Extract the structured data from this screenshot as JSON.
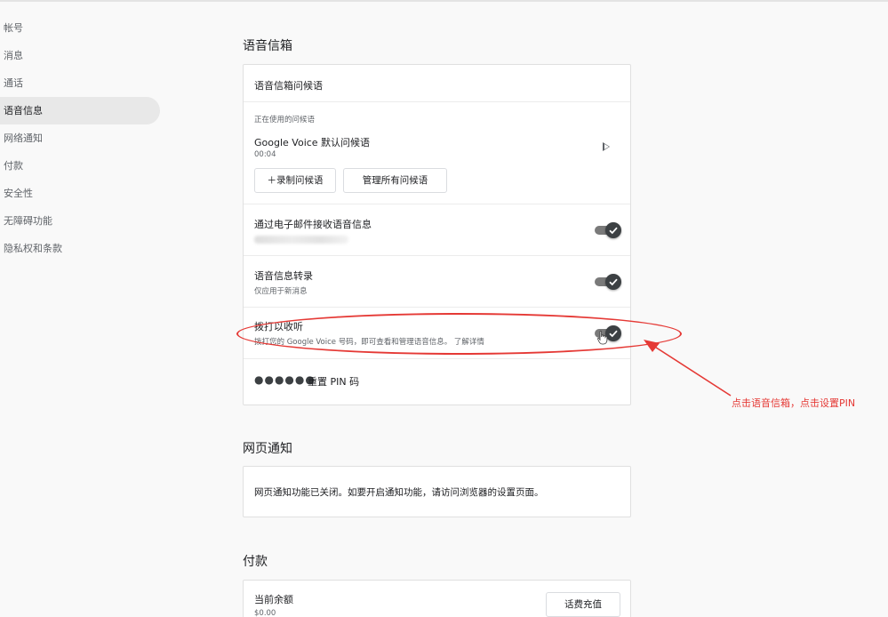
{
  "sidebar": {
    "items": [
      {
        "label": "帐号"
      },
      {
        "label": "消息"
      },
      {
        "label": "通话"
      },
      {
        "label": "语音信息"
      },
      {
        "label": "网络通知"
      },
      {
        "label": "付款"
      },
      {
        "label": "安全性"
      },
      {
        "label": "无障碍功能"
      },
      {
        "label": "隐私权和条款"
      }
    ]
  },
  "voicemail": {
    "title": "语音信箱",
    "greeting_header": "语音信箱问候语",
    "current_label": "正在使用的问候语",
    "greeting_name": "Google Voice 默认问候语",
    "greeting_duration": "00:04",
    "record_button": "＋录制问候语",
    "manage_button": "管理所有问候语",
    "email_label": "通过电子邮件接收语音信息",
    "transcribe_label": "语音信息转录",
    "transcribe_sub": "仅应用于新消息",
    "dial_label": "拨打以收听",
    "dial_sub": "拨打您的 Google Voice 号码，即可查看和管理语音信息。 了解详情",
    "pin_dots": "●●●●●●",
    "reset_pin": "重置 PIN 码"
  },
  "web_notifications": {
    "title": "网页通知",
    "text": "网页通知功能已关闭。如要开启通知功能，请访问浏览器的设置页面。"
  },
  "payments": {
    "title": "付款",
    "balance_label": "当前余额",
    "balance_value": "$0.00",
    "topup_button": "话费充值"
  },
  "annotation": {
    "text": "点击语音信箱，点击设置PIN",
    "color": "#e53935"
  }
}
